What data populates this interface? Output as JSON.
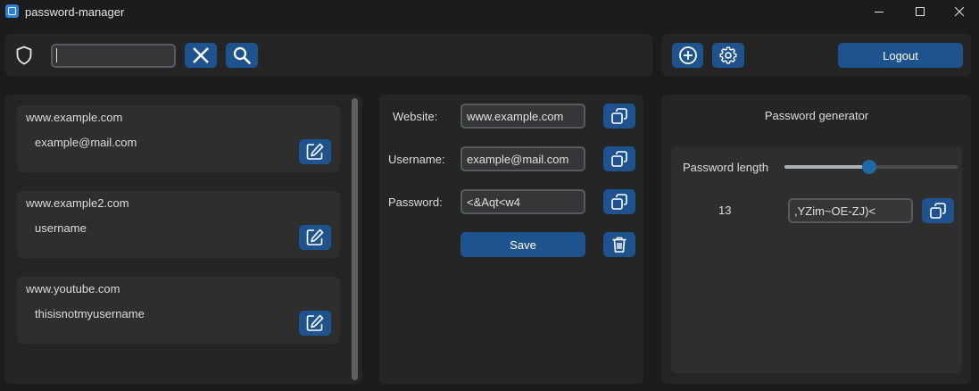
{
  "window": {
    "title": "password-manager"
  },
  "topbar": {
    "search": {
      "value": "",
      "placeholder": ""
    },
    "logout_label": "Logout"
  },
  "entries": [
    {
      "website": "www.example.com",
      "username": "example@mail.com"
    },
    {
      "website": "www.example2.com",
      "username": "username"
    },
    {
      "website": "www.youtube.com",
      "username": "thisisnotmyusername"
    }
  ],
  "details": {
    "website_label": "Website:",
    "website_value": "www.example.com",
    "username_label": "Username:",
    "username_value": "example@mail.com",
    "password_label": "Password:",
    "password_value": "<&Aqt<w4",
    "save_label": "Save"
  },
  "generator": {
    "title": "Password generator",
    "length_label": "Password length",
    "length_value": "13",
    "slider_fraction": 0.49,
    "generated": ",YZim~OE-ZJ)<"
  },
  "colors": {
    "accent": "#1f538d",
    "background": "#1c1c1c",
    "panel": "#252525",
    "card": "#2e2e2e"
  }
}
